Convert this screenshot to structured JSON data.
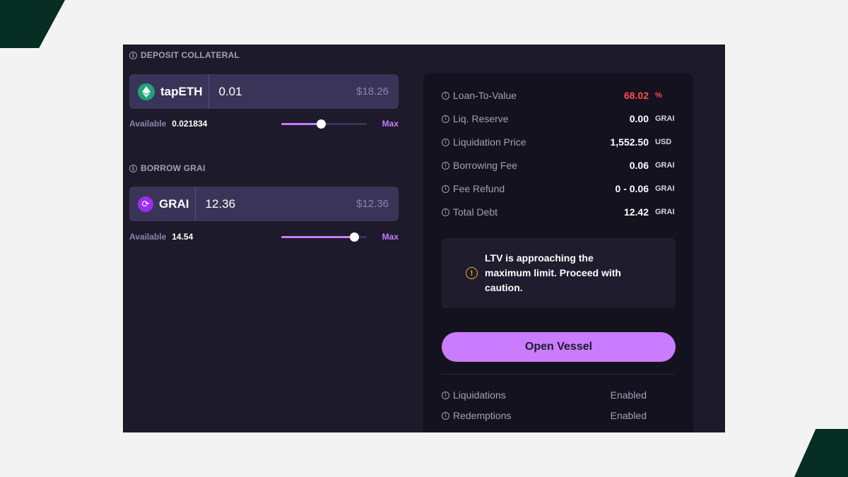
{
  "colors": {
    "accent": "#c97cff",
    "danger": "#ff4d4f",
    "warning": "#f5a623",
    "background": "#1d1a2b",
    "corner": "#062e22"
  },
  "deposit": {
    "label": "DEPOSIT COLLATERAL",
    "token": "tapETH",
    "token_icon": "ethereum-icon",
    "amount": "0.01",
    "usd": "$18.26",
    "available_label": "Available",
    "available_value": "0.021834",
    "slider_fraction": 0.46,
    "max_label": "Max"
  },
  "borrow": {
    "label": "BORROW GRAI",
    "token": "GRAI",
    "token_icon": "grai-icon",
    "amount": "12.36",
    "usd": "$12.36",
    "available_label": "Available",
    "available_value": "14.54",
    "slider_fraction": 0.85,
    "max_label": "Max"
  },
  "stats": [
    {
      "label": "Loan-To-Value",
      "value": "68.02",
      "unit": "%"
    },
    {
      "label": "Liq. Reserve",
      "value": "0.00",
      "unit": "GRAI"
    },
    {
      "label": "Liquidation Price",
      "value": "1,552.50",
      "unit": "USD"
    },
    {
      "label": "Borrowing Fee",
      "value": "0.06",
      "unit": "GRAI"
    },
    {
      "label": "Fee Refund",
      "value": "0 - 0.06",
      "unit": "GRAI"
    },
    {
      "label": "Total Debt",
      "value": "12.42",
      "unit": "GRAI"
    }
  ],
  "warning": {
    "text": "LTV is approaching the maximum limit. Proceed with caution."
  },
  "open_button": "Open Vessel",
  "flags": [
    {
      "label": "Liquidations",
      "value": "Enabled"
    },
    {
      "label": "Redemptions",
      "value": "Enabled"
    }
  ]
}
